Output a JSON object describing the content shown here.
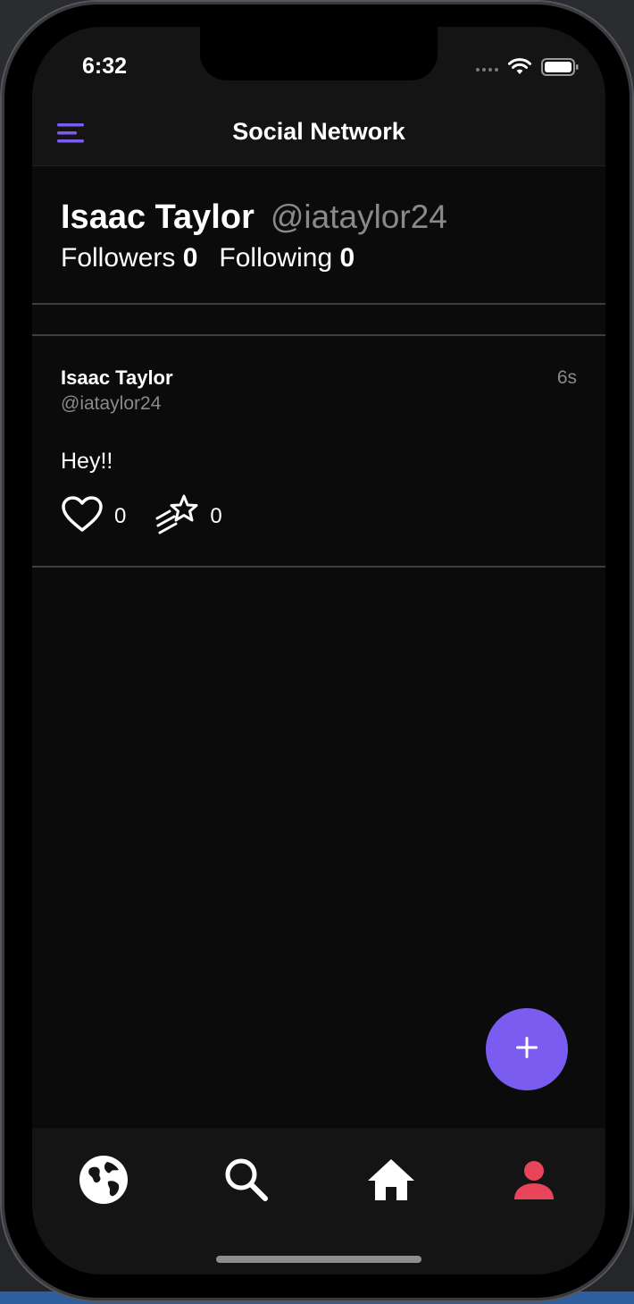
{
  "status_bar": {
    "time": "6:32",
    "icons": [
      "signal-dots-icon",
      "wifi-icon",
      "battery-icon"
    ]
  },
  "nav": {
    "title": "Social Network",
    "menu_icon": "menu-icon",
    "accent_color": "#7b5cf0"
  },
  "profile": {
    "name": "Isaac Taylor",
    "handle": "@iataylor24",
    "followers_label": "Followers",
    "followers_count": "0",
    "following_label": "Following",
    "following_count": "0"
  },
  "posts": [
    {
      "author": "Isaac Taylor",
      "handle": "@iataylor24",
      "time": "6s",
      "text": "Hey!!",
      "likes": "0",
      "stars": "0"
    }
  ],
  "fab": {
    "icon": "plus-icon",
    "color": "#7b5cf0"
  },
  "tabs": [
    {
      "name": "globe",
      "icon": "globe-icon",
      "active": false
    },
    {
      "name": "search",
      "icon": "search-icon",
      "active": false
    },
    {
      "name": "home",
      "icon": "home-icon",
      "active": false
    },
    {
      "name": "profile",
      "icon": "person-icon",
      "active": true,
      "active_color": "#e8455a"
    }
  ]
}
